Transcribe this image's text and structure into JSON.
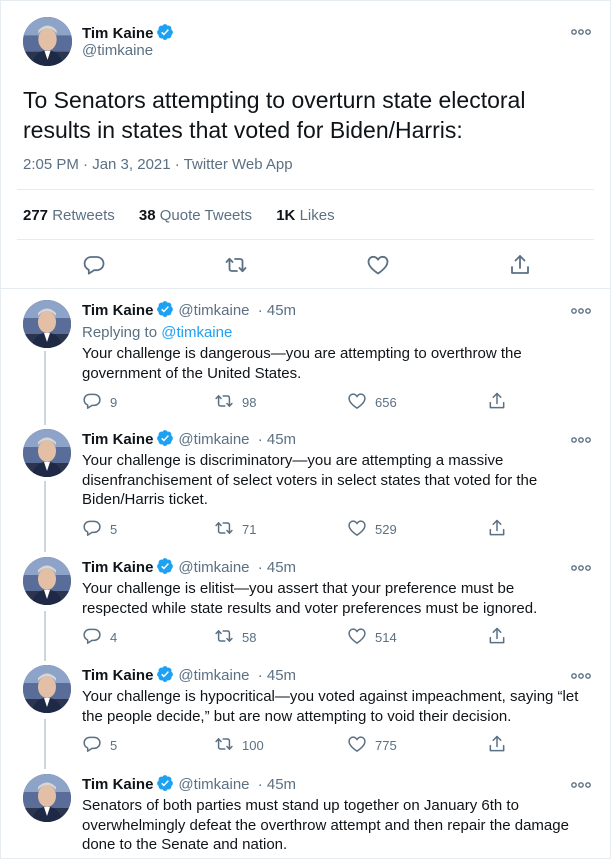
{
  "main_tweet": {
    "name": "Tim Kaine",
    "handle": "@timkaine",
    "text": "To Senators attempting to overturn state electoral results in states that voted for Biden/Harris:",
    "meta": "2:05 PM · Jan 3, 2021 · Twitter Web App",
    "stats": {
      "retweets_count": "277",
      "retweets_label": "Retweets",
      "quotes_count": "38",
      "quotes_label": "Quote Tweets",
      "likes_count": "1K",
      "likes_label": "Likes"
    }
  },
  "colors": {
    "accent": "#1da1f2",
    "muted": "#5b7083",
    "text": "#0f1419",
    "divider": "#e6ecf0"
  },
  "icons": [
    "reply-icon",
    "retweet-icon",
    "like-icon",
    "share-icon",
    "more-icon",
    "verified-badge-icon"
  ],
  "replies": [
    {
      "name": "Tim Kaine",
      "handle": "@timkaine",
      "time": "· 45m",
      "replying_prefix": "Replying to",
      "replying_to": "@timkaine",
      "text": "Your challenge is dangerous—you are attempting to overthrow the government of the United States.",
      "replies": "9",
      "retweets": "98",
      "likes": "656"
    },
    {
      "name": "Tim Kaine",
      "handle": "@timkaine",
      "time": "· 45m",
      "text": "Your challenge is discriminatory—you are attempting a massive disenfranchisement of select voters in select states that voted for the Biden/Harris ticket.",
      "replies": "5",
      "retweets": "71",
      "likes": "529"
    },
    {
      "name": "Tim Kaine",
      "handle": "@timkaine",
      "time": "· 45m",
      "text": "Your challenge is elitist—you assert that your preference must be respected while state results and voter preferences must be ignored.",
      "replies": "4",
      "retweets": "58",
      "likes": "514"
    },
    {
      "name": "Tim Kaine",
      "handle": "@timkaine",
      "time": "· 45m",
      "text": "Your challenge is hypocritical—you voted against impeachment, saying “let the people decide,” but are now attempting to void their decision.",
      "replies": "5",
      "retweets": "100",
      "likes": "775"
    },
    {
      "name": "Tim Kaine",
      "handle": "@timkaine",
      "time": "· 45m",
      "text": "Senators of both parties must stand up together on January 6th to overwhelmingly defeat the overthrow attempt and then repair the damage done to the Senate and nation."
    }
  ]
}
